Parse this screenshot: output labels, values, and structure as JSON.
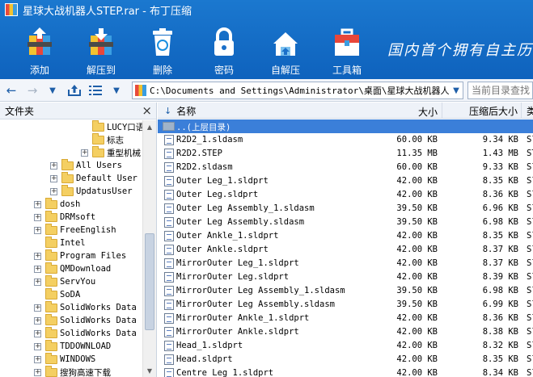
{
  "window": {
    "title": "星球大战机器人STEP.rar - 布丁压缩"
  },
  "toolbar": [
    {
      "label": "添加",
      "icon": "add-archive-icon"
    },
    {
      "label": "解压到",
      "icon": "extract-to-icon"
    },
    {
      "label": "删除",
      "icon": "recycle-bin-icon"
    },
    {
      "label": "密码",
      "icon": "lock-icon"
    },
    {
      "label": "自解压",
      "icon": "self-extract-icon"
    },
    {
      "label": "工具箱",
      "icon": "toolbox-icon"
    }
  ],
  "slogan": "国内首个拥有自主历",
  "nav": {
    "address": "C:\\Documents and Settings\\Administrator\\桌面\\星球大战机器人STEP.rar",
    "search_placeholder": "当前目录查找"
  },
  "left_pane": {
    "title": "文件夹",
    "close": "×",
    "tree": [
      {
        "label": "LUCY口语",
        "indent": 6,
        "expander": ""
      },
      {
        "label": "标志",
        "indent": 6,
        "expander": ""
      },
      {
        "label": "重型机械",
        "indent": 5,
        "expander": "+"
      },
      {
        "label": "All Users",
        "indent": 3,
        "expander": "+"
      },
      {
        "label": "Default User",
        "indent": 3,
        "expander": "+"
      },
      {
        "label": "UpdatusUser",
        "indent": 3,
        "expander": "+"
      },
      {
        "label": "dosh",
        "indent": 2,
        "expander": "+"
      },
      {
        "label": "DRMsoft",
        "indent": 2,
        "expander": "+"
      },
      {
        "label": "FreeEnglish",
        "indent": 2,
        "expander": "+"
      },
      {
        "label": "Intel",
        "indent": 2,
        "expander": ""
      },
      {
        "label": "Program Files",
        "indent": 2,
        "expander": "+"
      },
      {
        "label": "QMDownload",
        "indent": 2,
        "expander": "+"
      },
      {
        "label": "ServYou",
        "indent": 2,
        "expander": "+"
      },
      {
        "label": "SoDA",
        "indent": 2,
        "expander": ""
      },
      {
        "label": "SolidWorks Data",
        "indent": 2,
        "expander": "+"
      },
      {
        "label": "SolidWorks Data",
        "indent": 2,
        "expander": "+"
      },
      {
        "label": "SolidWorks Data",
        "indent": 2,
        "expander": "+"
      },
      {
        "label": "TDDOWNLOAD",
        "indent": 2,
        "expander": "+"
      },
      {
        "label": "WINDOWS",
        "indent": 2,
        "expander": "+"
      },
      {
        "label": "搜狗高速下载",
        "indent": 2,
        "expander": "+"
      }
    ]
  },
  "file_list": {
    "columns": {
      "name": "名称",
      "size": "大小",
      "compressed": "压缩后大小",
      "type": "类"
    },
    "parent_row": "..(上层目录)",
    "rows": [
      {
        "name": "R2D2_1.sldasm",
        "size": "60.00 KB",
        "compressed": "9.34 KB",
        "type": "Sl"
      },
      {
        "name": "R2D2.STEP",
        "size": "11.35 MB",
        "compressed": "1.43 MB",
        "type": "ST"
      },
      {
        "name": "R2D2.sldasm",
        "size": "60.00 KB",
        "compressed": "9.33 KB",
        "type": "Sl"
      },
      {
        "name": "Outer Leg_1.sldprt",
        "size": "42.00 KB",
        "compressed": "8.35 KB",
        "type": "Sl"
      },
      {
        "name": "Outer Leg.sldprt",
        "size": "42.00 KB",
        "compressed": "8.36 KB",
        "type": "Sl"
      },
      {
        "name": "Outer Leg Assembly_1.sldasm",
        "size": "39.50 KB",
        "compressed": "6.96 KB",
        "type": "Sl"
      },
      {
        "name": "Outer Leg Assembly.sldasm",
        "size": "39.50 KB",
        "compressed": "6.98 KB",
        "type": "Sl"
      },
      {
        "name": "Outer Ankle_1.sldprt",
        "size": "42.00 KB",
        "compressed": "8.35 KB",
        "type": "Sl"
      },
      {
        "name": "Outer Ankle.sldprt",
        "size": "42.00 KB",
        "compressed": "8.37 KB",
        "type": "Sl"
      },
      {
        "name": "MirrorOuter Leg_1.sldprt",
        "size": "42.00 KB",
        "compressed": "8.37 KB",
        "type": "Sl"
      },
      {
        "name": "MirrorOuter Leg.sldprt",
        "size": "42.00 KB",
        "compressed": "8.39 KB",
        "type": "Sl"
      },
      {
        "name": "MirrorOuter Leg Assembly_1.sldasm",
        "size": "39.50 KB",
        "compressed": "6.98 KB",
        "type": "Sl"
      },
      {
        "name": "MirrorOuter Leg Assembly.sldasm",
        "size": "39.50 KB",
        "compressed": "6.99 KB",
        "type": "Sl"
      },
      {
        "name": "MirrorOuter Ankle_1.sldprt",
        "size": "42.00 KB",
        "compressed": "8.36 KB",
        "type": "Sl"
      },
      {
        "name": "MirrorOuter Ankle.sldprt",
        "size": "42.00 KB",
        "compressed": "8.38 KB",
        "type": "Sl"
      },
      {
        "name": "Head_1.sldprt",
        "size": "42.00 KB",
        "compressed": "8.32 KB",
        "type": "Sl"
      },
      {
        "name": "Head.sldprt",
        "size": "42.00 KB",
        "compressed": "8.35 KB",
        "type": "Sl"
      },
      {
        "name": "Centre Leg_1.sldprt",
        "size": "42.00 KB",
        "compressed": "8.34 KB",
        "type": "Sl"
      }
    ]
  }
}
